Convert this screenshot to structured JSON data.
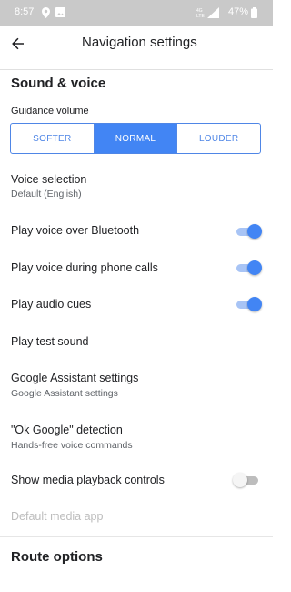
{
  "status_bar": {
    "time": "8:57",
    "battery": "47%",
    "icons": [
      "location-icon",
      "image-icon",
      "4g-signal-icon",
      "battery-icon"
    ]
  },
  "app_bar": {
    "title": "Navigation settings",
    "back_icon": "arrow-back-icon"
  },
  "sound_voice": {
    "title": "Sound & voice",
    "guidance_volume_label": "Guidance volume",
    "volume_options": [
      {
        "label": "SOFTER",
        "selected": false
      },
      {
        "label": "NORMAL",
        "selected": true
      },
      {
        "label": "LOUDER",
        "selected": false
      }
    ],
    "voice_selection": {
      "title": "Voice selection",
      "value": "Default (English)"
    },
    "play_voice_bluetooth": {
      "title": "Play voice over Bluetooth",
      "enabled": true
    },
    "play_voice_calls": {
      "title": "Play voice during phone calls",
      "enabled": true
    },
    "play_audio_cues": {
      "title": "Play audio cues",
      "enabled": true
    },
    "play_test_sound": {
      "title": "Play test sound"
    },
    "google_assistant": {
      "title": "Google Assistant settings",
      "subtitle": "Google Assistant settings"
    },
    "ok_google": {
      "title": "\"Ok Google\" detection",
      "subtitle": "Hands-free voice commands"
    },
    "media_controls": {
      "title": "Show media playback controls",
      "enabled": false
    },
    "default_media_app": {
      "title": "Default media app",
      "disabled": true
    }
  },
  "route_options": {
    "title": "Route options"
  },
  "colors": {
    "accent": "#4285f4",
    "status_bar": "#c9c9c9"
  }
}
